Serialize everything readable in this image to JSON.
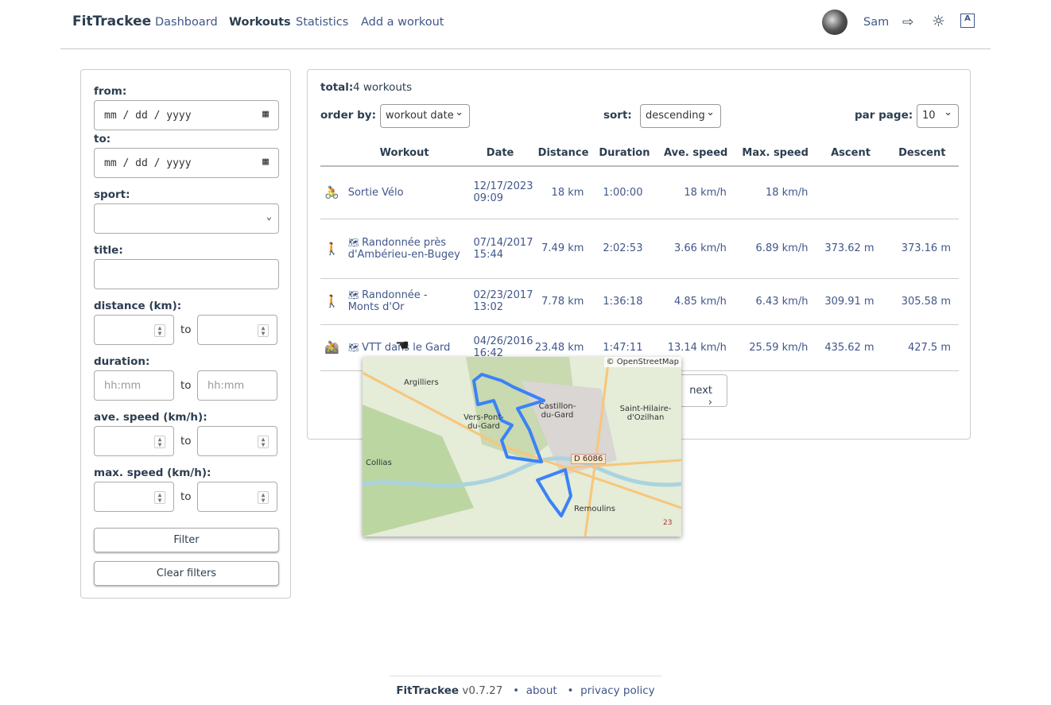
{
  "nav": {
    "brand": "FitTrackee",
    "links": [
      "Dashboard",
      "Workouts",
      "Statistics",
      "Add a workout"
    ],
    "user": "Sam"
  },
  "filters": {
    "from": "from:",
    "to_label": "to:",
    "date_placeholder": "mm / dd / yyyy",
    "sport": "sport:",
    "title": "title:",
    "distance": "distance (km):",
    "duration": "duration:",
    "ave_speed": "ave. speed (km/h):",
    "max_speed": "max. speed (km/h):",
    "to": "to",
    "duration_placeholder": "hh:mm",
    "filter": "Filter",
    "clear": "Clear filters"
  },
  "main": {
    "total_label": "total:",
    "total_value": "4 workouts",
    "order_by": "order by:",
    "order_value": "workout date",
    "sort": "sort:",
    "sort_value": "descending",
    "per_page": "par page:",
    "per_page_value": "10",
    "next": "next",
    "columns": [
      "Workout",
      "Date",
      "Distance",
      "Duration",
      "Ave. speed",
      "Max. speed",
      "Ascent",
      "Descent"
    ],
    "rows": [
      {
        "sport": "cycling",
        "color": "#3f9a7c",
        "title": "Sortie Vélo",
        "date": "12/17/2023",
        "time": "09:09",
        "distance": "18 km",
        "duration": "1:00:00",
        "ave": "18 km/h",
        "max": "18 km/h",
        "ascent": "",
        "descent": "",
        "map": false
      },
      {
        "sport": "hiking",
        "color": "#a05a5a",
        "title": "Randonnée près d'Ambérieu-en-Bugey",
        "date": "07/14/2017",
        "time": "15:44",
        "distance": "7.49 km",
        "duration": "2:02:53",
        "ave": "3.66 km/h",
        "max": "6.89 km/h",
        "ascent": "373.62 m",
        "descent": "373.16 m",
        "map": true
      },
      {
        "sport": "hiking",
        "color": "#a05a5a",
        "title": "Randonnée - Monts d'Or",
        "date": "02/23/2017",
        "time": "13:02",
        "distance": "7.78 km",
        "duration": "1:36:18",
        "ave": "4.85 km/h",
        "max": "6.43 km/h",
        "ascent": "309.91 m",
        "descent": "305.58 m",
        "map": true
      },
      {
        "sport": "mountain-biking",
        "color": "#d4a85a",
        "title": "VTT dans le Gard",
        "date": "04/26/2016",
        "time": "16:42",
        "distance": "23.48 km",
        "duration": "1:47:11",
        "ave": "13.14 km/h",
        "max": "25.59 km/h",
        "ascent": "435.62 m",
        "descent": "427.5 m",
        "map": true
      }
    ]
  },
  "map": {
    "attribution": "© OpenStreetMap",
    "places": [
      "Argilliers",
      "Vers-Pont-du-Gard",
      "Castillon-du-Gard",
      "Saint-Hilaire-d'Ozilhan",
      "Collias",
      "D 6086",
      "Remoulins",
      "23"
    ]
  },
  "footer": {
    "brand": "FitTrackee",
    "version": "v0.7.27",
    "about": "about",
    "privacy": "privacy policy"
  }
}
